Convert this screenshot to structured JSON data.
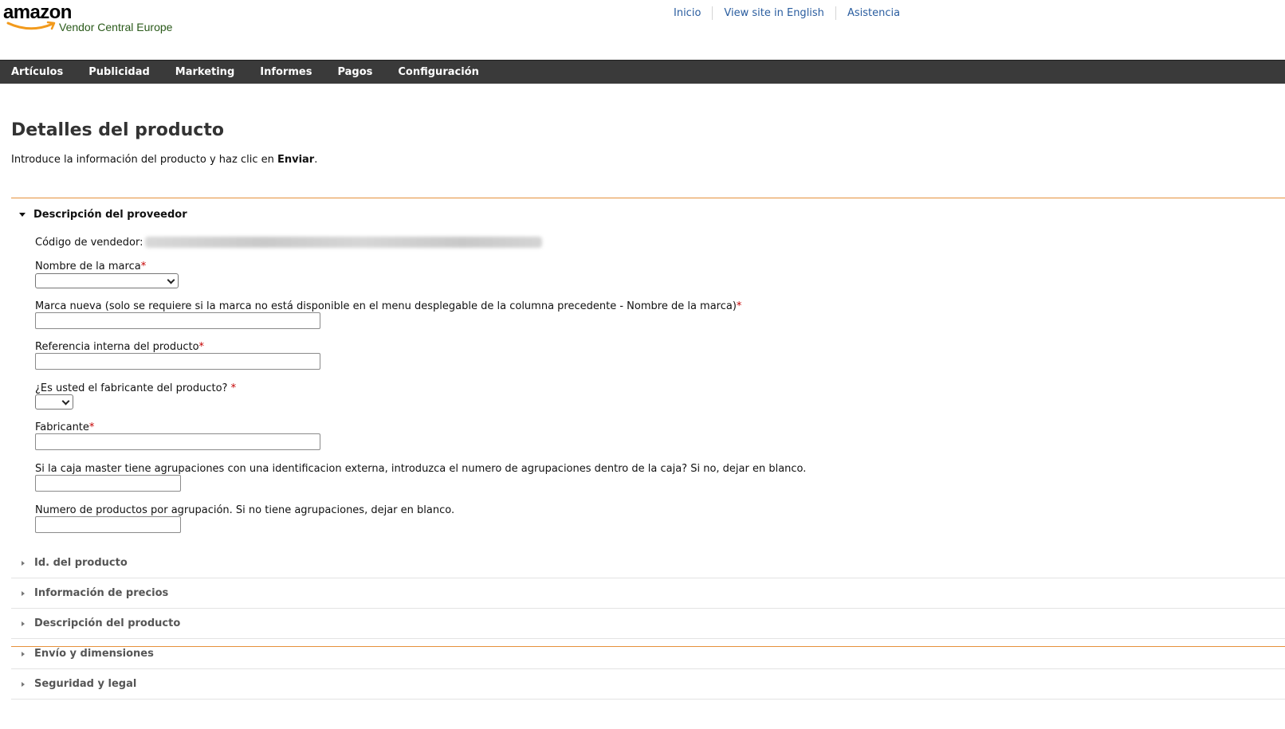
{
  "header": {
    "logo_word": "amazon",
    "logo_sub": "Vendor Central Europe",
    "links": [
      "Inicio",
      "View site in English",
      "Asistencia"
    ]
  },
  "nav": {
    "items": [
      "Artículos",
      "Publicidad",
      "Marketing",
      "Informes",
      "Pagos",
      "Configuración"
    ]
  },
  "page": {
    "title": "Detalles del producto",
    "intro_prefix": "Introduce la información del producto y haz clic en ",
    "intro_bold": "Enviar",
    "intro_suffix": "."
  },
  "section_vendor": {
    "title": "Descripción del proveedor",
    "vendor_code_label": "Código de vendedor:",
    "brand_label": "Nombre de la marca",
    "new_brand_label": "Marca nueva (solo se requiere si la marca no está disponible en el menu desplegable de la columna precedente - Nombre de la marca)",
    "internal_ref_label": "Referencia interna del producto",
    "manufacturer_q_label": "¿Es usted el fabricante del producto? ",
    "manufacturer_label": "Fabricante",
    "master_box_label": "Si la caja master tiene agrupaciones con una identificacion externa, introduzca el numero de agrupaciones dentro de la caja? Si no, dejar en blanco.",
    "products_per_group_label": "Numero de productos por agrupación. Si no tiene agrupaciones, dejar en blanco.",
    "required_mark": "*"
  },
  "collapsed_sections": [
    "Id. del producto",
    "Información de precios",
    "Descripción del producto",
    "Envío y dimensiones",
    "Seguridad y legal"
  ],
  "colors": {
    "accent_line": "#e6913b",
    "nav_bg": "#3a3a3a",
    "link": "#2a5d9f",
    "required": "#c40000"
  }
}
